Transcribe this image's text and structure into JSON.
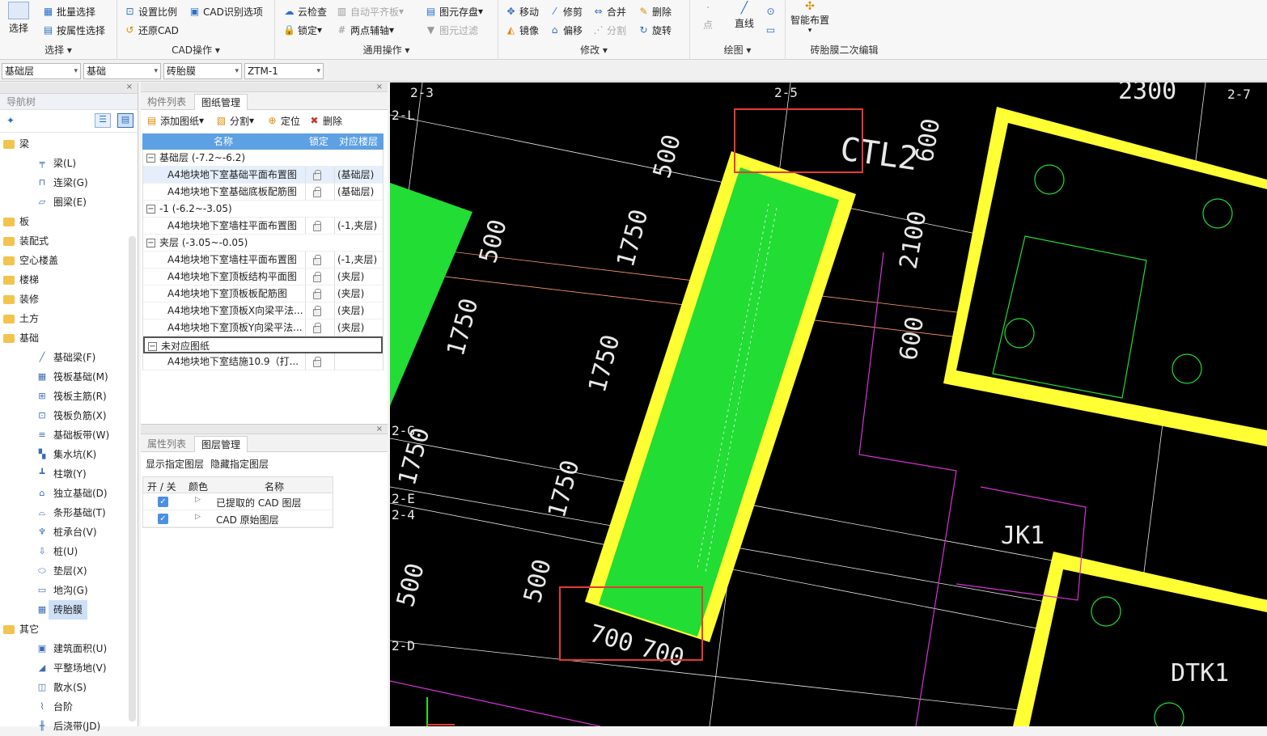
{
  "ribbon": {
    "select_big": "选择",
    "batch_select": "批量选择",
    "select_by_attr": "按属性选择",
    "select_group": "选择",
    "set_scale": "设置比例",
    "cad_options": "CAD识别选项",
    "restore_cad": "还原CAD",
    "cad_group": "CAD操作",
    "cloud_check": "云检查",
    "auto_level": "自动平齐板",
    "lock": "锁定",
    "two_point_axis": "两点辅轴",
    "element_save": "图元存盘",
    "element_filter": "图元过滤",
    "common_group": "通用操作",
    "move": "移动",
    "trim": "修剪",
    "merge": "合并",
    "delete": "删除",
    "mirror": "镜像",
    "offset": "偏移",
    "split": "分割",
    "rotate": "旋转",
    "modify_group": "修改",
    "point": "点",
    "line": "直线",
    "draw_group": "绘图",
    "smart_layout": "智能布置",
    "brick_group": "砖胎膜二次编辑"
  },
  "selectors": {
    "layer": "基础层",
    "type": "基础",
    "component": "砖胎膜",
    "name": "ZTM-1"
  },
  "nav": {
    "title": "导航树",
    "tree": [
      {
        "kind": "cat",
        "label": "梁",
        "icon": "folder-icon"
      },
      {
        "kind": "leaf",
        "label": "梁(L)",
        "icon": "beam-icon"
      },
      {
        "kind": "leaf",
        "label": "连梁(G)",
        "icon": "link-beam-icon"
      },
      {
        "kind": "leaf",
        "label": "圈梁(E)",
        "icon": "ring-beam-icon"
      },
      {
        "kind": "cat",
        "label": "板",
        "icon": "folder-icon"
      },
      {
        "kind": "cat",
        "label": "装配式",
        "icon": "folder-icon"
      },
      {
        "kind": "cat",
        "label": "空心楼盖",
        "icon": "folder-icon"
      },
      {
        "kind": "cat",
        "label": "楼梯",
        "icon": "folder-icon"
      },
      {
        "kind": "cat",
        "label": "装修",
        "icon": "folder-icon"
      },
      {
        "kind": "cat",
        "label": "土方",
        "icon": "folder-icon"
      },
      {
        "kind": "cat",
        "label": "基础",
        "icon": "folder-icon"
      },
      {
        "kind": "leaf",
        "label": "基础梁(F)",
        "icon": "foundation-beam-icon"
      },
      {
        "kind": "leaf",
        "label": "筏板基础(M)",
        "icon": "raft-icon"
      },
      {
        "kind": "leaf",
        "label": "筏板主筋(R)",
        "icon": "raft-main-rebar-icon"
      },
      {
        "kind": "leaf",
        "label": "筏板负筋(X)",
        "icon": "raft-neg-rebar-icon"
      },
      {
        "kind": "leaf",
        "label": "基础板带(W)",
        "icon": "slab-strip-icon"
      },
      {
        "kind": "leaf",
        "label": "集水坑(K)",
        "icon": "sump-icon"
      },
      {
        "kind": "leaf",
        "label": "柱墩(Y)",
        "icon": "pier-icon"
      },
      {
        "kind": "leaf",
        "label": "独立基础(D)",
        "icon": "isolated-footing-icon"
      },
      {
        "kind": "leaf",
        "label": "条形基础(T)",
        "icon": "strip-footing-icon"
      },
      {
        "kind": "leaf",
        "label": "桩承台(V)",
        "icon": "pile-cap-icon"
      },
      {
        "kind": "leaf",
        "label": "桩(U)",
        "icon": "pile-icon"
      },
      {
        "kind": "leaf",
        "label": "垫层(X)",
        "icon": "cushion-icon"
      },
      {
        "kind": "leaf",
        "label": "地沟(G)",
        "icon": "trench-icon"
      },
      {
        "kind": "leaf",
        "label": "砖胎膜",
        "icon": "brick-mold-icon",
        "active": true
      },
      {
        "kind": "cat",
        "label": "其它",
        "icon": "folder-icon"
      },
      {
        "kind": "leaf",
        "label": "建筑面积(U)",
        "icon": "area-icon"
      },
      {
        "kind": "leaf",
        "label": "平整场地(V)",
        "icon": "grading-icon"
      },
      {
        "kind": "leaf",
        "label": "散水(S)",
        "icon": "apron-icon"
      },
      {
        "kind": "leaf",
        "label": "台阶",
        "icon": "steps-icon"
      },
      {
        "kind": "leaf",
        "label": "后浇带(JD)",
        "icon": "post-pour-icon"
      }
    ]
  },
  "drawings": {
    "tab1": "构件列表",
    "tab2": "图纸管理",
    "add": "添加图纸",
    "split": "分割",
    "locate": "定位",
    "delete": "删除",
    "col_name": "名称",
    "col_lock": "锁定",
    "col_floor": "对应楼层",
    "rows": [
      {
        "group": true,
        "label": "基础层 (-7.2~-6.2)"
      },
      {
        "label": "A4地块地下室基础平面布置图",
        "floor": "(基础层)",
        "sel": true
      },
      {
        "label": "A4地块地下室基础底板配筋图",
        "floor": "(基础层)"
      },
      {
        "group": true,
        "label": "-1 (-6.2~-3.05)"
      },
      {
        "label": "A4地块地下室墙柱平面布置图",
        "floor": "(-1,夹层)"
      },
      {
        "group": true,
        "label": "夹层 (-3.05~-0.05)"
      },
      {
        "label": "A4地块地下室墙柱平面布置图",
        "floor": "(-1,夹层)"
      },
      {
        "label": "A4地块地下室顶板结构平面图",
        "floor": "(夹层)"
      },
      {
        "label": "A4地块地下室顶板板配筋图",
        "floor": "(夹层)"
      },
      {
        "label": "A4地块地下室顶板X向梁平法...",
        "floor": "(夹层)"
      },
      {
        "label": "A4地块地下室顶板Y向梁平法...",
        "floor": "(夹层)"
      },
      {
        "group": true,
        "label": "未对应图纸",
        "boxed": true
      },
      {
        "label": "A4地块地下室结施10.9（打...",
        "floor": ""
      }
    ]
  },
  "layers": {
    "tab1": "属性列表",
    "tab2": "图层管理",
    "show": "显示指定图层",
    "hide": "隐藏指定图层",
    "col_onoff": "开 / 关",
    "col_color": "颜色",
    "col_name": "名称",
    "rows": [
      {
        "name": "已提取的 CAD 图层"
      },
      {
        "name": "CAD 原始图层"
      }
    ]
  },
  "cad": {
    "axis_labels": [
      "2-3",
      "2-5",
      "2-7",
      "2-L",
      "2-G",
      "2-E",
      "2-4",
      "2-D"
    ],
    "dims": [
      "2300",
      "600",
      "500",
      "1750",
      "500",
      "1750",
      "2100",
      "600",
      "1750",
      "1750",
      "500",
      "700",
      "700",
      "500",
      "1750"
    ],
    "texts": [
      "CTL2",
      "JK1",
      "DTK1"
    ]
  },
  "colors": {
    "brick": "#ffff33",
    "fill": "#22dd33",
    "highlight": "#e53935",
    "magenta": "#d633d6",
    "white": "#e8e8e8"
  }
}
